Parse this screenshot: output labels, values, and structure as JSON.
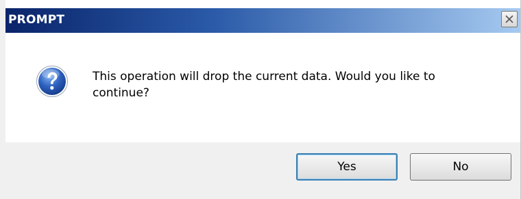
{
  "dialog": {
    "title": "PROMPT",
    "message": "This operation will drop the current data. Would you like to continue?",
    "icon": "question-icon",
    "buttons": {
      "yes_label": "Yes",
      "no_label": "No"
    }
  },
  "colors": {
    "titlebar_start": "#0a246a",
    "titlebar_end": "#a6caf0",
    "icon_blue": "#1f4fa8",
    "footer_bg": "#f0f0f0"
  }
}
